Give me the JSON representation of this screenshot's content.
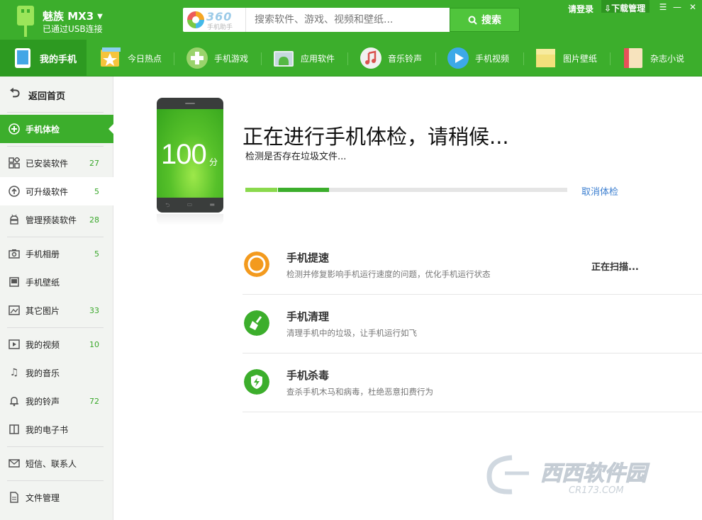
{
  "header": {
    "device_name": "魅族 MX3",
    "connection_status": "已通过USB连接",
    "logo_text": "360",
    "logo_sub": "手机助手",
    "search_placeholder": "搜索软件、游戏、视频和壁纸...",
    "search_button": "搜索",
    "login_label": "请登录",
    "download_label": "下载管理"
  },
  "nav": {
    "items": [
      {
        "label": "我的手机",
        "icon": "phone-icon"
      },
      {
        "label": "今日热点",
        "icon": "star-icon"
      },
      {
        "label": "手机游戏",
        "icon": "gamepad-icon"
      },
      {
        "label": "应用软件",
        "icon": "android-icon"
      },
      {
        "label": "音乐铃声",
        "icon": "music-icon"
      },
      {
        "label": "手机视频",
        "icon": "play-icon"
      },
      {
        "label": "图片壁纸",
        "icon": "picture-icon"
      },
      {
        "label": "杂志小说",
        "icon": "book-icon"
      }
    ]
  },
  "sidebar": {
    "back_label": "返回首页",
    "items": [
      {
        "label": "手机体检",
        "count": "",
        "icon": "plus-circle-icon"
      },
      {
        "label": "已安装软件",
        "count": "27",
        "icon": "apps-icon"
      },
      {
        "label": "可升级软件",
        "count": "5",
        "icon": "upgrade-icon"
      },
      {
        "label": "管理预装软件",
        "count": "28",
        "icon": "android-icon"
      },
      {
        "label": "手机相册",
        "count": "5",
        "icon": "camera-icon"
      },
      {
        "label": "手机壁纸",
        "count": "",
        "icon": "wallpaper-icon"
      },
      {
        "label": "其它图片",
        "count": "33",
        "icon": "image-icon"
      },
      {
        "label": "我的视频",
        "count": "10",
        "icon": "video-icon"
      },
      {
        "label": "我的音乐",
        "count": "",
        "icon": "music-note-icon"
      },
      {
        "label": "我的铃声",
        "count": "72",
        "icon": "bell-icon"
      },
      {
        "label": "我的电子书",
        "count": "",
        "icon": "ebook-icon"
      },
      {
        "label": "短信、联系人",
        "count": "",
        "icon": "mail-icon"
      },
      {
        "label": "文件管理",
        "count": "",
        "icon": "file-icon"
      }
    ]
  },
  "checkup": {
    "score": "100",
    "score_unit": "分",
    "title": "正在进行手机体检，请稍候...",
    "subtitle": "检测是否存在垃圾文件...",
    "progress_percent": 26,
    "cancel_label": "取消体检",
    "tasks": [
      {
        "title": "手机提速",
        "desc": "检测并修复影响手机运行速度的问题，优化手机运行状态",
        "status": "正在扫描..."
      },
      {
        "title": "手机清理",
        "desc": "清理手机中的垃圾，让手机运行如飞",
        "status": ""
      },
      {
        "title": "手机杀毒",
        "desc": "查杀手机木马和病毒，杜绝恶意扣费行为",
        "status": ""
      }
    ]
  },
  "colors": {
    "brand_green": "#3cae2c",
    "accent_orange": "#f39a1e",
    "link_blue": "#3c7fd0"
  }
}
